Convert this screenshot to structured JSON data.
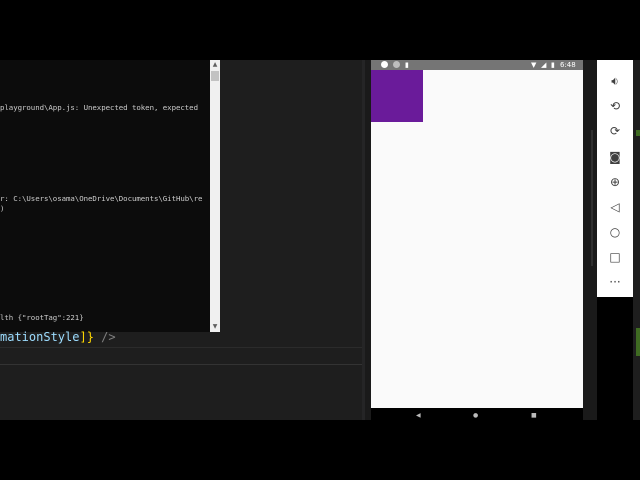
{
  "terminal": {
    "lines": [
      "playground\\App.js: Unexpected token, expected",
      "r: C:\\Users\\osama\\OneDrive\\Documents\\GitHub\\re",
      ")",
      "lth {\"rootTag\":221}"
    ]
  },
  "editor": {
    "code_name": "mationStyle",
    "code_close": "]}",
    "code_tag": " />"
  },
  "phone": {
    "status_time": "6:48",
    "box_color": "#6a1b9a"
  },
  "toolbar": {
    "icons": [
      "volume-down-icon",
      "rotate-left-icon",
      "rotate-right-icon",
      "camera-icon",
      "zoom-icon",
      "back-icon",
      "home-icon",
      "overview-icon",
      "more-icon"
    ]
  }
}
